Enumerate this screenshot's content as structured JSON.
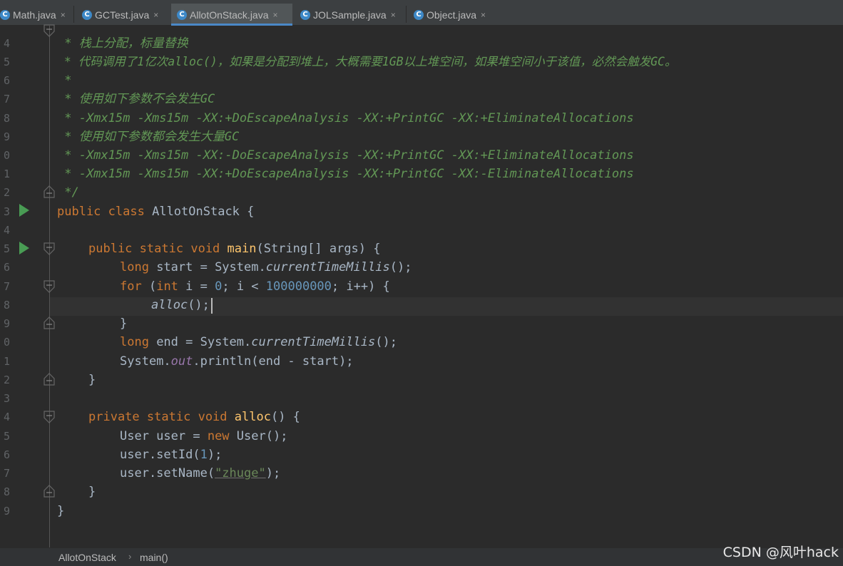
{
  "tabs": [
    {
      "label": "Math.java",
      "close": "×"
    },
    {
      "label": "GCTest.java",
      "close": "×"
    },
    {
      "label": "AllotOnStack.java",
      "close": "×"
    },
    {
      "label": "JOLSample.java",
      "close": "×"
    },
    {
      "label": "Object.java",
      "close": "×"
    }
  ],
  "active_tab": "AllotOnStack.java",
  "icon_letter": "C",
  "line_numbers": [
    "4",
    "5",
    "6",
    "7",
    "8",
    "9",
    "0",
    "1",
    "2",
    "3",
    "4",
    "5",
    "6",
    "7",
    "8",
    "9",
    "0",
    "1",
    "2",
    "3",
    "4",
    "5",
    "6",
    "7",
    "8",
    "9"
  ],
  "code": {
    "c1": " * 栈上分配，标量替换",
    "c2": " * 代码调用了1亿次alloc()，如果是分配到堆上，大概需要1GB以上堆空间，如果堆空间小于该值，必然会触发GC。",
    "c3": " *",
    "c4": " * 使用如下参数不会发生GC",
    "c5": " * -Xmx15m -Xms15m -XX:+DoEscapeAnalysis -XX:+PrintGC -XX:+EliminateAllocations",
    "c6": " * 使用如下参数都会发生大量GC",
    "c7": " * -Xmx15m -Xms15m -XX:-DoEscapeAnalysis -XX:+PrintGC -XX:+EliminateAllocations",
    "c8": " * -Xmx15m -Xms15m -XX:+DoEscapeAnalysis -XX:+PrintGC -XX:-EliminateAllocations",
    "c9": " */",
    "kw_public": "public",
    "kw_class": "class",
    "kw_static": "static",
    "kw_void": "void",
    "kw_long": "long",
    "kw_for": "for",
    "kw_int": "int",
    "kw_private": "private",
    "kw_new": "new",
    "class_name": " AllotOnStack {",
    "main_name": "main",
    "main_params": "(String[] args) {",
    "start_decl": " start = System.",
    "ctm": "currentTimeMillis",
    "call_end": "();",
    "for_open": " (",
    "for_mid": " i = ",
    "zero": "0",
    "for_cond": "; i < ",
    "big_num": "100000000",
    "for_close": "; i++) {",
    "alloc_call": "alloc",
    "call_parens": "();",
    "brace_close": "}",
    "end_decl": " end = System.",
    "sysout_pre": "System.",
    "out_field": "out",
    "println_call": ".println(end - start);",
    "alloc_def": "alloc",
    "alloc_def_rest": "() {",
    "user_decl": "User user = ",
    "user_ctor": " User();",
    "setid_pre": "user.setId(",
    "one": "1",
    "setid_post": ");",
    "setname_pre": "user.setName(",
    "name_str": "\"zhuge\"",
    "setname_post": ");"
  },
  "breadcrumb": {
    "file": "AllotOnStack",
    "sep": "›",
    "method": "main()"
  },
  "watermark": "CSDN @风叶hack",
  "colors": {
    "keyword": "#cc7832",
    "comment": "#629755",
    "number": "#6897bb",
    "function": "#ffc66d",
    "string": "#6a8759",
    "text": "#a9b7c6",
    "run": "#499c54",
    "tab_active_underline": "#4a88c7"
  }
}
